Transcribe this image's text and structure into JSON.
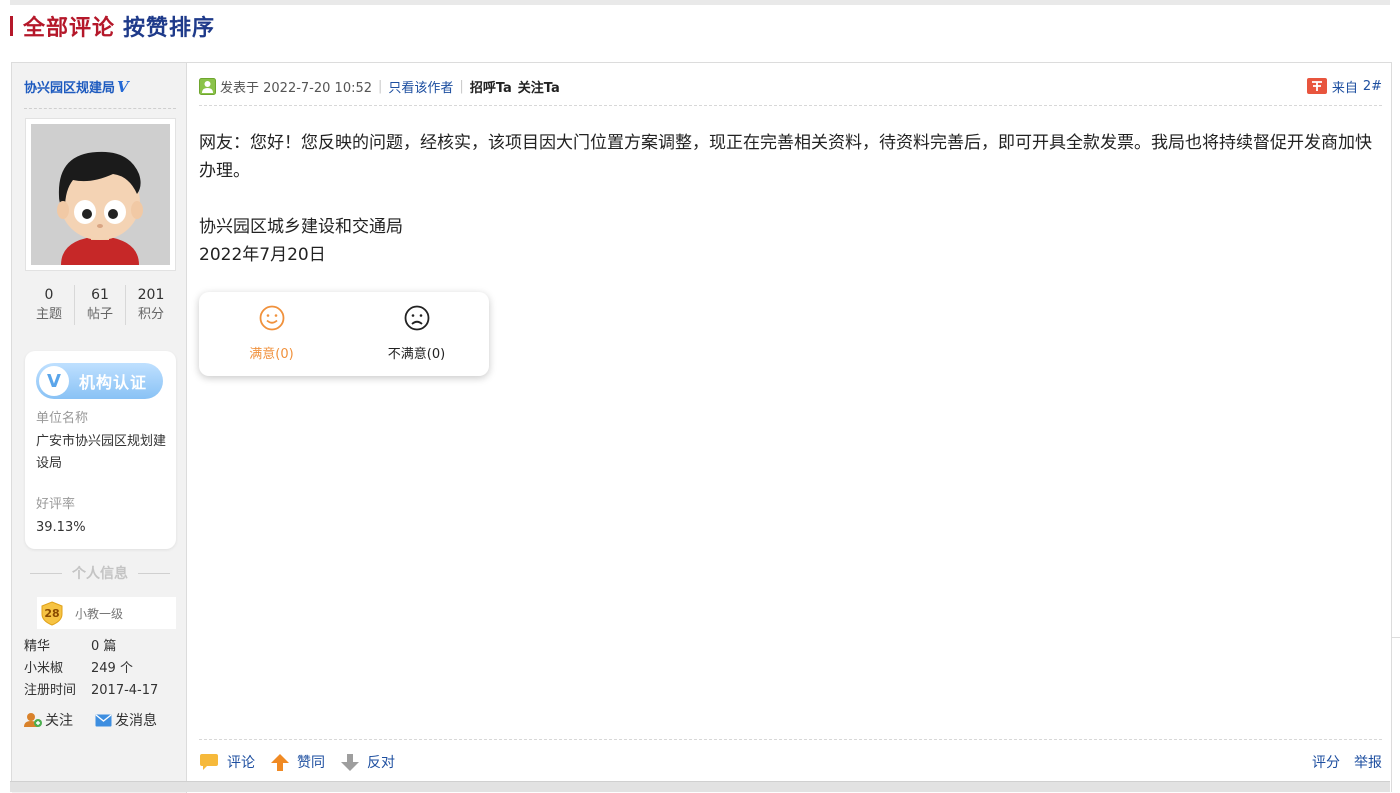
{
  "section": {
    "title_all": "全部评论",
    "title_sort": "按赞排序"
  },
  "author": {
    "name": "协兴园区规建局",
    "verified_mark": "V",
    "stats": [
      {
        "value": "0",
        "label": "主题"
      },
      {
        "value": "61",
        "label": "帖子"
      },
      {
        "value": "201",
        "label": "积分"
      }
    ],
    "org": {
      "badge_text": "机构认证",
      "badge_icon": "V",
      "unit_label": "单位名称",
      "unit_value": "广安市协兴园区规划建设局",
      "rating_label": "好评率",
      "rating_value": "39.13%"
    },
    "personal_title": "个人信息",
    "level": {
      "number": "28",
      "name": "小教一级"
    },
    "info": [
      {
        "key": "精华",
        "value": "0 篇"
      },
      {
        "key": "小米椒",
        "value": "249 个"
      },
      {
        "key": "注册时间",
        "value": "2017-4-17"
      }
    ],
    "actions": {
      "follow": "关注",
      "message": "发消息"
    }
  },
  "post": {
    "posted_at": "发表于 2022-7-20 10:52",
    "only_author": "只看该作者",
    "greet": "招呼Ta",
    "follow": "关注Ta",
    "from_label": "来自",
    "floor": "2#",
    "body": [
      "网友：您好！您反映的问题，经核实，该项目因大门位置方案调整，现正在完善相关资料，待资料完善后，即可开具全款发票。我局也将持续督促开发商加快办理。",
      "",
      "协兴园区城乡建设和交通局",
      "2022年7月20日"
    ],
    "ratings": {
      "satisfied": "满意(0)",
      "unsatisfied": "不满意(0)"
    },
    "footer": {
      "comment": "评论",
      "agree": "赞同",
      "oppose": "反对",
      "score": "评分",
      "report": "举报"
    }
  },
  "colors": {
    "title_red": "#b5182a",
    "title_blue": "#1e3a8a",
    "link_blue": "#1e4fa0",
    "satisfied_orange": "#f0913c"
  }
}
